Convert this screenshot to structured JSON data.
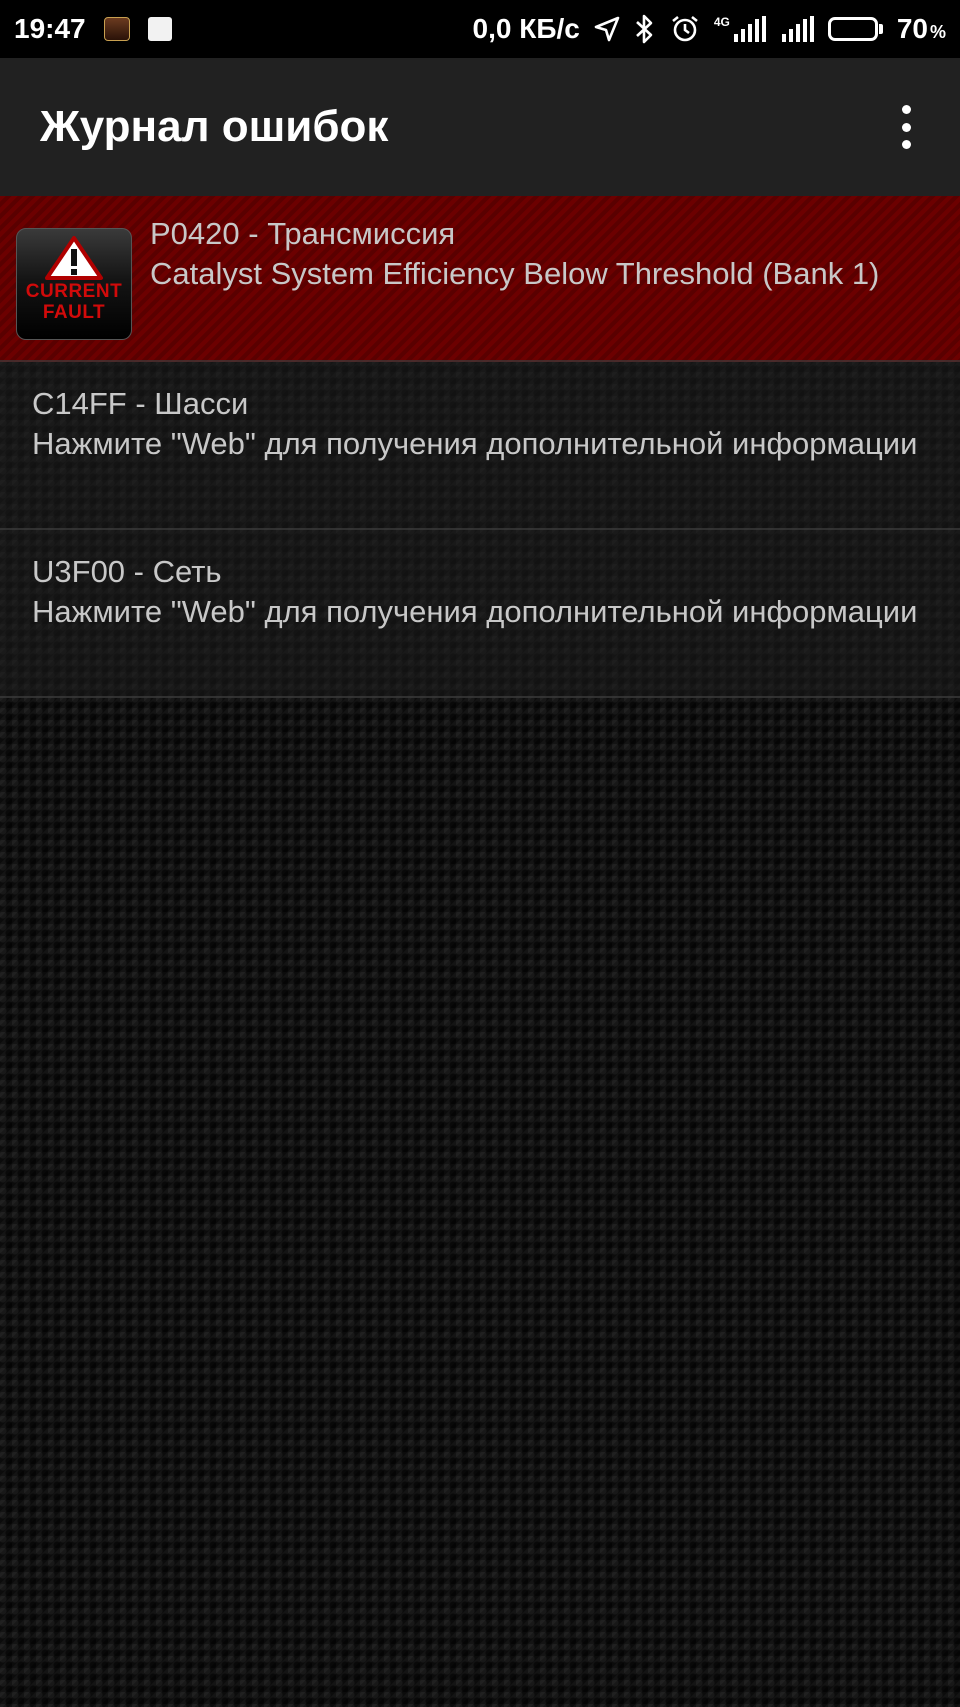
{
  "status_bar": {
    "time": "19:47",
    "speed": "0,0 КБ/с",
    "network": "4G",
    "battery": "70",
    "battery_unit": "%",
    "battery_level": 0.7
  },
  "app_bar": {
    "title": "Журнал ошибок"
  },
  "faults": [
    {
      "code": "P0420 - Трансмиссия",
      "description": "Catalyst System Efficiency Below Threshold (Bank 1)",
      "status": "current",
      "badge_line1": "CURRENT",
      "badge_line2": "FAULT"
    },
    {
      "code": "C14FF - Шасси",
      "description": "Нажмите \"Web\" для получения дополнительной информации",
      "status": "normal"
    },
    {
      "code": "U3F00 - Сеть",
      "description": "Нажмите \"Web\" для получения дополнительной информации",
      "status": "normal"
    }
  ],
  "colors": {
    "current_fault_bg": "#5f0000",
    "app_bar_bg": "#212121",
    "badge_text": "#d10a0a"
  }
}
